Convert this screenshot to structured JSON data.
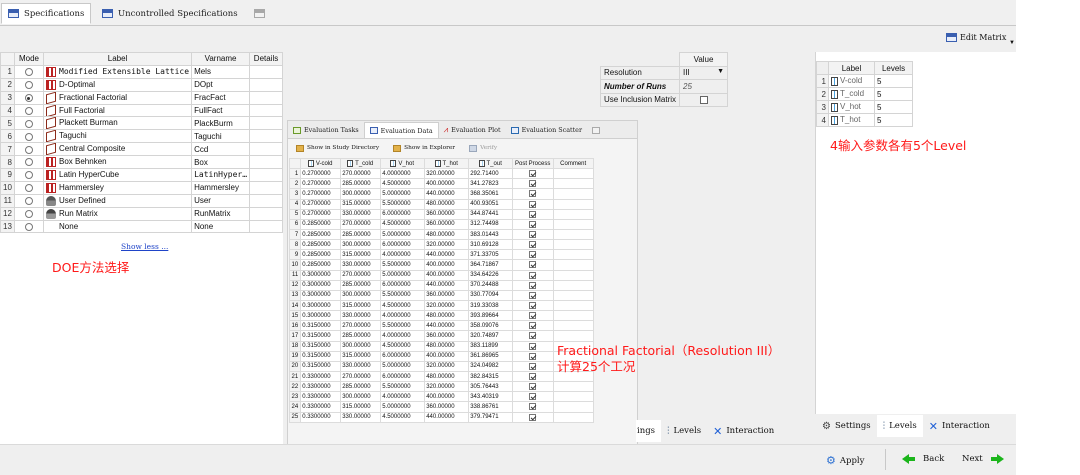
{
  "top_tabs": [
    {
      "label": "Specifications",
      "active": true
    },
    {
      "label": "Uncontrolled Specifications",
      "active": false
    }
  ],
  "doe": {
    "headers": {
      "mode": "Mode",
      "label": "Label",
      "varname": "Varname",
      "details": "Details"
    },
    "rows": [
      {
        "num": "1",
        "selected": false,
        "icon": "grid-icon",
        "label": "Modified Extensible Lattice",
        "varname": "Mels"
      },
      {
        "num": "2",
        "selected": false,
        "icon": "grid-icon",
        "label": "D-Optimal",
        "varname": "DOpt"
      },
      {
        "num": "3",
        "selected": true,
        "icon": "cube-icon",
        "label": "Fractional Factorial",
        "varname": "FracFact"
      },
      {
        "num": "4",
        "selected": false,
        "icon": "cube-icon",
        "label": "Full Factorial",
        "varname": "FullFact"
      },
      {
        "num": "5",
        "selected": false,
        "icon": "cube-icon",
        "label": "Plackett Burman",
        "varname": "PlackBurm"
      },
      {
        "num": "6",
        "selected": false,
        "icon": "cube-icon",
        "label": "Taguchi",
        "varname": "Taguchi"
      },
      {
        "num": "7",
        "selected": false,
        "icon": "cube-icon",
        "label": "Central Composite",
        "varname": "Ccd"
      },
      {
        "num": "8",
        "selected": false,
        "icon": "grid-icon",
        "label": "Box Behnken",
        "varname": "Box"
      },
      {
        "num": "9",
        "selected": false,
        "icon": "grid-icon",
        "label": "Latin HyperCube",
        "varname": "LatinHyper…"
      },
      {
        "num": "10",
        "selected": false,
        "icon": "grid-icon",
        "label": "Hammersley",
        "varname": "Hammersley"
      },
      {
        "num": "11",
        "selected": false,
        "icon": "user-icon",
        "label": "User Defined",
        "varname": "User"
      },
      {
        "num": "12",
        "selected": false,
        "icon": "run-icon",
        "label": "Run Matrix",
        "varname": "RunMatrix"
      },
      {
        "num": "13",
        "selected": false,
        "icon": "",
        "label": "None",
        "varname": "None"
      }
    ],
    "show_less": "Show less ..."
  },
  "annotations": {
    "doe_select": "DOE方法选择",
    "levels_note": "4输入参数各有5个Level",
    "fractional_line1": "Fractional Factorial（Resolution III）",
    "fractional_line2": "计算25个工况"
  },
  "resolution": {
    "value_header": "Value",
    "rows": [
      {
        "label": "Resolution",
        "value": "III",
        "type": "select"
      },
      {
        "label": "Number of Runs",
        "value": "25",
        "type": "readonly"
      },
      {
        "label": "Use Inclusion Matrix",
        "value": "",
        "type": "checkbox"
      }
    ]
  },
  "levels": {
    "edit_matrix": "Edit Matrix",
    "headers": {
      "label": "Label",
      "levels": "Levels"
    },
    "rows": [
      {
        "num": "1",
        "label": "V-cold",
        "levels": "5"
      },
      {
        "num": "2",
        "label": "T_cold",
        "levels": "5"
      },
      {
        "num": "3",
        "label": "V_hot",
        "levels": "5"
      },
      {
        "num": "4",
        "label": "T_hot",
        "levels": "5"
      }
    ]
  },
  "evaluation": {
    "tabs": [
      "Evaluation Tasks",
      "Evaluation Data",
      "Evaluation Plot",
      "Evaluation Scatter"
    ],
    "active_tab": 1,
    "toolbar": {
      "show_study": "Show in Study Directory",
      "show_explorer": "Show in Explorer",
      "verify": "Verify"
    },
    "headers": [
      "V-cold",
      "T_cold",
      "V_hot",
      "T_hot",
      "T_out",
      "Post Process",
      "Comment"
    ],
    "rows": [
      [
        "0.2700000",
        "270.00000",
        "4.0000000",
        "320.00000",
        "292.71400"
      ],
      [
        "0.2700000",
        "285.00000",
        "4.5000000",
        "400.00000",
        "341.27823"
      ],
      [
        "0.2700000",
        "300.00000",
        "5.0000000",
        "440.00000",
        "368.35061"
      ],
      [
        "0.2700000",
        "315.00000",
        "5.5000000",
        "480.00000",
        "400.93051"
      ],
      [
        "0.2700000",
        "330.00000",
        "6.0000000",
        "360.00000",
        "344.87441"
      ],
      [
        "0.2850000",
        "270.00000",
        "4.5000000",
        "360.00000",
        "312.74498"
      ],
      [
        "0.2850000",
        "285.00000",
        "5.0000000",
        "480.00000",
        "383.01443"
      ],
      [
        "0.2850000",
        "300.00000",
        "6.0000000",
        "320.00000",
        "310.69128"
      ],
      [
        "0.2850000",
        "315.00000",
        "4.0000000",
        "440.00000",
        "371.33705"
      ],
      [
        "0.2850000",
        "330.00000",
        "5.5000000",
        "400.00000",
        "364.71867"
      ],
      [
        "0.3000000",
        "270.00000",
        "5.0000000",
        "400.00000",
        "334.64226"
      ],
      [
        "0.3000000",
        "285.00000",
        "6.0000000",
        "440.00000",
        "370.24488"
      ],
      [
        "0.3000000",
        "300.00000",
        "5.5000000",
        "360.00000",
        "330.77094"
      ],
      [
        "0.3000000",
        "315.00000",
        "4.5000000",
        "320.00000",
        "319.33038"
      ],
      [
        "0.3000000",
        "330.00000",
        "4.0000000",
        "480.00000",
        "393.89664"
      ],
      [
        "0.3150000",
        "270.00000",
        "5.5000000",
        "440.00000",
        "358.09076"
      ],
      [
        "0.3150000",
        "285.00000",
        "4.0000000",
        "360.00000",
        "320.74897"
      ],
      [
        "0.3150000",
        "300.00000",
        "4.5000000",
        "480.00000",
        "383.11899"
      ],
      [
        "0.3150000",
        "315.00000",
        "6.0000000",
        "400.00000",
        "361.86965"
      ],
      [
        "0.3150000",
        "330.00000",
        "5.0000000",
        "320.00000",
        "324.04982"
      ],
      [
        "0.3300000",
        "270.00000",
        "6.0000000",
        "480.00000",
        "382.84315"
      ],
      [
        "0.3300000",
        "285.00000",
        "5.5000000",
        "320.00000",
        "305.76443"
      ],
      [
        "0.3300000",
        "300.00000",
        "4.0000000",
        "400.00000",
        "343.40319"
      ],
      [
        "0.3300000",
        "315.00000",
        "5.0000000",
        "360.00000",
        "338.86761"
      ],
      [
        "0.3300000",
        "330.00000",
        "4.5000000",
        "440.00000",
        "379.79471"
      ]
    ]
  },
  "bottom_tabs_mid": {
    "settings_partial": "ings",
    "levels": "Levels",
    "interaction": "Interaction"
  },
  "bottom_tabs_right": {
    "settings": "Settings",
    "levels": "Levels",
    "interaction": "Interaction"
  },
  "footer": {
    "apply": "Apply",
    "back": "Back",
    "next": "Next"
  },
  "colors": {
    "annotation": "#ff1a1a",
    "arrow_green": "#1bb51b",
    "link_blue": "#1f44c8"
  }
}
